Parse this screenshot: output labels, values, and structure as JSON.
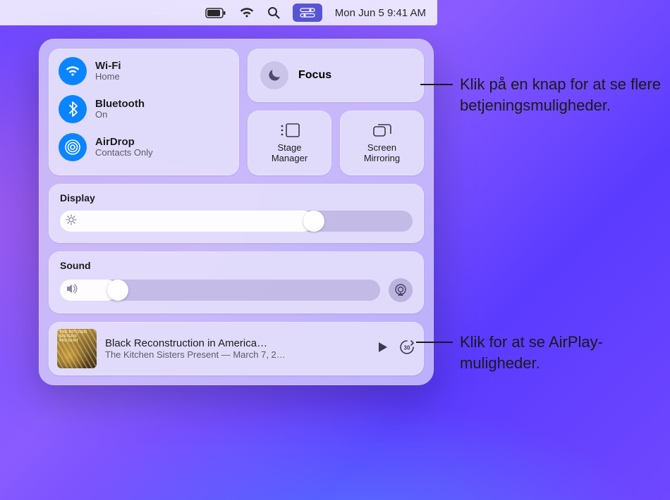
{
  "menubar": {
    "date_time": "Mon Jun 5  9:41 AM"
  },
  "connectivity": {
    "wifi": {
      "title": "Wi-Fi",
      "sub": "Home"
    },
    "bluetooth": {
      "title": "Bluetooth",
      "sub": "On"
    },
    "airdrop": {
      "title": "AirDrop",
      "sub": "Contacts Only"
    }
  },
  "focus": {
    "title": "Focus"
  },
  "stage": {
    "label_line1": "Stage",
    "label_line2": "Manager"
  },
  "mirror": {
    "label_line1": "Screen",
    "label_line2": "Mirroring"
  },
  "display": {
    "head": "Display",
    "value_pct": 72
  },
  "sound": {
    "head": "Sound",
    "value_pct": 18
  },
  "now_playing": {
    "art_caption": "THE KITCHEN SISTERS PRESENT",
    "title": "Black Reconstruction in America…",
    "subtitle": "The Kitchen Sisters Present — March 7, 2…"
  },
  "callouts": {
    "focus": "Klik på en knap for at se flere betjeningsmuligheder.",
    "airplay": "Klik for at se AirPlay-muligheder."
  }
}
